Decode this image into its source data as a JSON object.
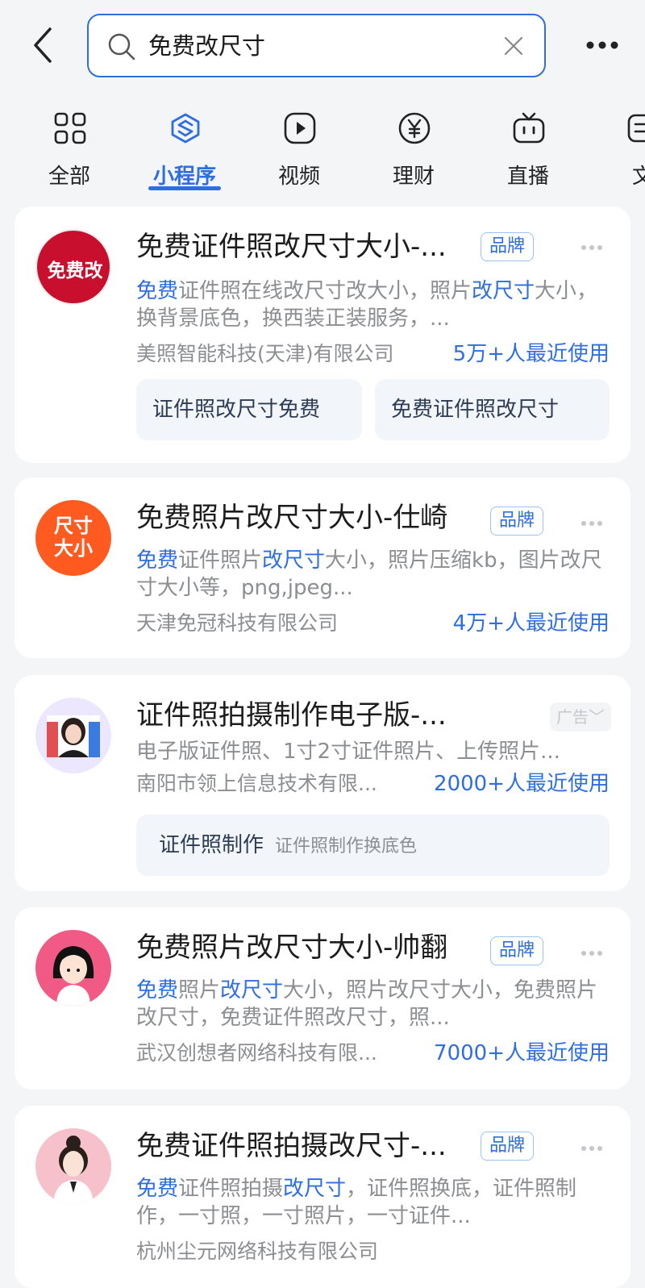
{
  "search": {
    "query": "免费改尺寸"
  },
  "tabs": [
    {
      "label": "全部",
      "icon": "grid-icon"
    },
    {
      "label": "小程序",
      "icon": "mini-program-icon",
      "active": true
    },
    {
      "label": "视频",
      "icon": "play-icon"
    },
    {
      "label": "理财",
      "icon": "yen-icon"
    },
    {
      "label": "直播",
      "icon": "tv-icon"
    },
    {
      "label": "文",
      "icon": "article-icon"
    }
  ],
  "results": [
    {
      "icon_text": "免费改",
      "icon_color": "#c8102e",
      "title": "免费证件照改尺寸大小-...",
      "tag": "品牌",
      "desc_parts": [
        {
          "text": "免费",
          "hl": true
        },
        {
          "text": "证件照在线改尺寸改大小，照片",
          "hl": false
        },
        {
          "text": "改尺寸",
          "hl": true
        },
        {
          "text": "大小，换背景底色，换西装正装服务，...",
          "hl": false
        }
      ],
      "company": "美照智能科技(天津)有限公司",
      "usage": "5万+人最近使用",
      "chips": [
        "证件照改尺寸免费",
        "免费证件照改尺寸"
      ]
    },
    {
      "icon_text_line1": "尺寸",
      "icon_text_line2": "大小",
      "icon_color": "#ff5a1f",
      "title": "免费照片改尺寸大小-仕崎",
      "tag": "品牌",
      "desc_parts": [
        {
          "text": "免费",
          "hl": true
        },
        {
          "text": "证件照片",
          "hl": false
        },
        {
          "text": "改尺寸",
          "hl": true
        },
        {
          "text": "大小，照片压缩kb，图片改尺寸大小等，png,jpeg...",
          "hl": false
        }
      ],
      "company": "天津免冠科技有限公司",
      "usage": "4万+人最近使用"
    },
    {
      "title": "证件照拍摄制作电子版-...",
      "tag": "广告",
      "desc": "电子版证件照、1寸2寸证件照片、上传照片...",
      "company": "南阳市领上信息技术有限...",
      "usage": "2000+人最近使用",
      "chip_main": "证件照制作",
      "chip_sub": "证件照制作换底色"
    },
    {
      "icon_color": "#f05a85",
      "title": "免费照片改尺寸大小-帅翻",
      "tag": "品牌",
      "desc_parts": [
        {
          "text": "免费",
          "hl": true
        },
        {
          "text": "照片",
          "hl": false
        },
        {
          "text": "改尺寸",
          "hl": true
        },
        {
          "text": "大小，照片改尺寸大小，免费照片改尺寸，免费证件照改尺寸，照...",
          "hl": false
        }
      ],
      "company": "武汉创想者网络科技有限...",
      "usage": "7000+人最近使用"
    },
    {
      "icon_color": "#f7c1cb",
      "title": "免费证件照拍摄改尺寸-...",
      "tag": "品牌",
      "desc_parts": [
        {
          "text": "免费",
          "hl": true
        },
        {
          "text": "证件照拍摄",
          "hl": false
        },
        {
          "text": "改尺寸",
          "hl": true
        },
        {
          "text": "，证件照换底，证件照制作，一寸照，一寸照片，一寸证件...",
          "hl": false
        }
      ],
      "company": "杭州尘元网络科技有限公司"
    }
  ]
}
